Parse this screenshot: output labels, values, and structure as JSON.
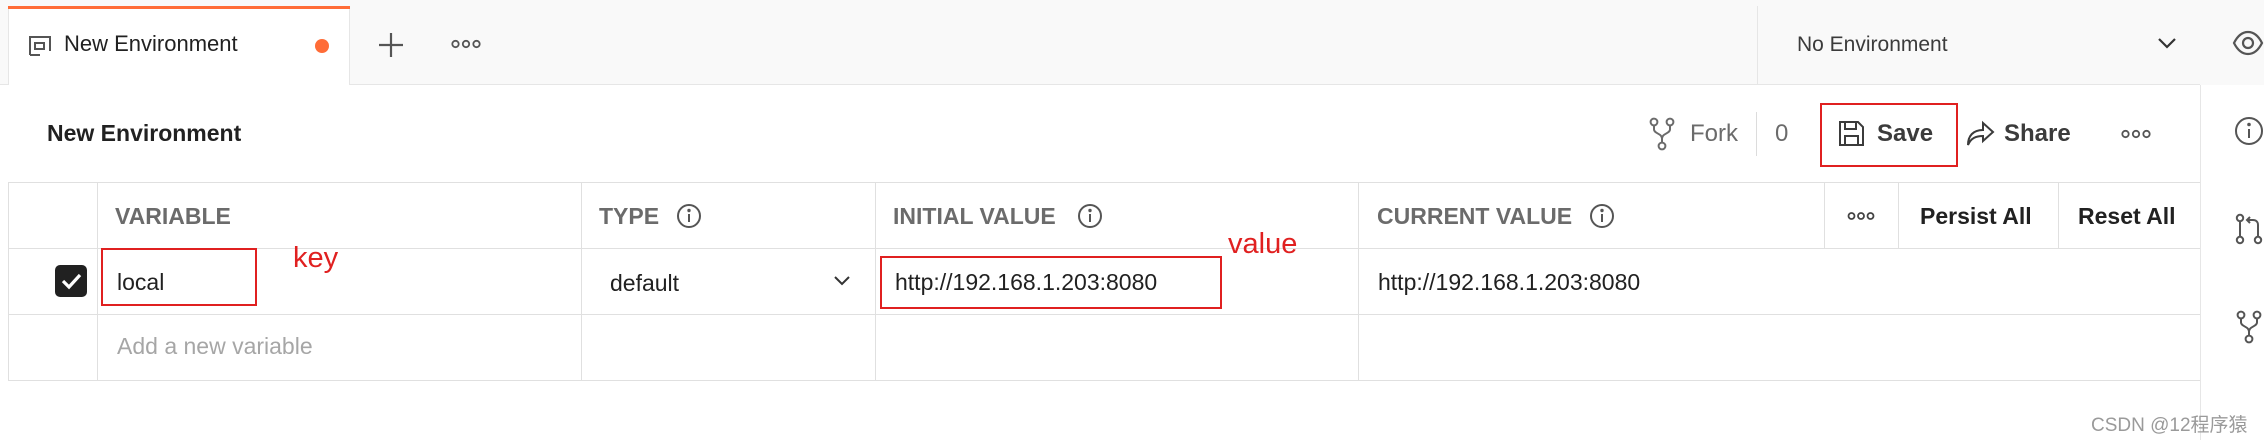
{
  "tab": {
    "title": "New Environment",
    "unsaved_dot_color": "#ff6c37"
  },
  "environment_selector": {
    "label": "No Environment"
  },
  "header": {
    "title": "New Environment",
    "fork_label": "Fork",
    "fork_count": "0",
    "save_label": "Save",
    "share_label": "Share"
  },
  "table": {
    "columns": {
      "variable": "VARIABLE",
      "type": "TYPE",
      "initial_value": "INITIAL VALUE",
      "current_value": "CURRENT VALUE"
    },
    "persist_all": "Persist All",
    "reset_all": "Reset All",
    "rows": [
      {
        "checked": true,
        "variable": "local",
        "type": "default",
        "initial_value": "http://192.168.1.203:8080",
        "current_value": "http://192.168.1.203:8080"
      }
    ],
    "add_placeholder": "Add a new variable"
  },
  "annotations": {
    "key_label": "key",
    "value_label": "value",
    "color": "#e02020"
  },
  "watermark": "CSDN @12程序猿",
  "colors": {
    "accent": "#ff6c37",
    "annotation": "#e02020"
  }
}
